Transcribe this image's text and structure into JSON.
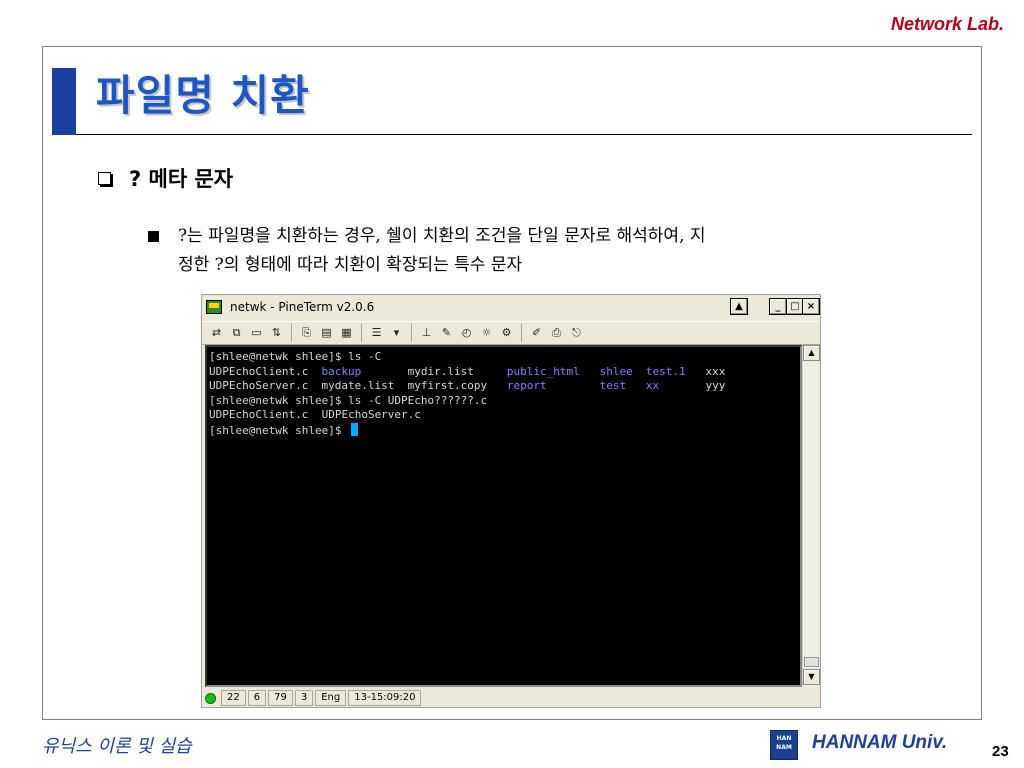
{
  "header": {
    "lab_label": "Network Lab."
  },
  "slide": {
    "title": "파일명 치환",
    "bullet1": "? 메타 문자",
    "bullet2_line1": "?는 파일명을 치환하는 경우, 쉘이 치환의 조건을 단일 문자로 해석하여, 지",
    "bullet2_line2": "정한 ?의 형태에 따라 치환이 확장되는 특수 문자"
  },
  "window": {
    "title": "netwk - PineTerm v2.0.6",
    "buttons": {
      "extra": "▲",
      "minimize": "_",
      "maximize": "□",
      "close": "×"
    }
  },
  "toolbar": {
    "icons": [
      "connect-icon",
      "disconnect-icon",
      "new-window-icon",
      "transfer-icon",
      "copy-icon",
      "paste-icon",
      "paste-all-icon",
      "menu-icon",
      "dropdown-icon",
      "line-icon",
      "log-icon",
      "capture-icon",
      "slow-icon",
      "settings-icon",
      "edit-icon",
      "print-icon",
      "exit-icon"
    ]
  },
  "terminal": {
    "lines": [
      {
        "cols": [
          {
            "text": "[shlee@netwk shlee]$ ls -C",
            "dir": false
          }
        ]
      },
      {
        "cols": [
          {
            "text": "UDPEchoClient.c",
            "dir": false
          },
          {
            "text": "backup",
            "dir": true
          },
          {
            "text": "mydir.list",
            "dir": false
          },
          {
            "text": "public_html",
            "dir": true
          },
          {
            "text": "shlee",
            "dir": true
          },
          {
            "text": "test.1",
            "dir": true
          },
          {
            "text": "xxx",
            "dir": false
          }
        ]
      },
      {
        "cols": [
          {
            "text": "UDPEchoServer.c",
            "dir": false
          },
          {
            "text": "mydate.list",
            "dir": false
          },
          {
            "text": "myfirst.copy",
            "dir": false
          },
          {
            "text": "report",
            "dir": true
          },
          {
            "text": "test",
            "dir": true
          },
          {
            "text": "xx",
            "dir": true
          },
          {
            "text": "yyy",
            "dir": false
          }
        ]
      },
      {
        "cols": [
          {
            "text": "[shlee@netwk shlee]$ ls -C UDPEcho??????.c",
            "dir": false
          }
        ]
      },
      {
        "cols": [
          {
            "text": "UDPEchoClient.c  UDPEchoServer.c",
            "dir": false
          }
        ]
      },
      {
        "cols": [
          {
            "text": "[shlee@netwk shlee]$ ",
            "dir": false
          }
        ],
        "cursor": true
      }
    ]
  },
  "statusbar": {
    "cells": [
      "22",
      "6",
      "79",
      "3",
      "Eng",
      "13-15:09:20"
    ]
  },
  "footer": {
    "course": "유닉스 이론 및 실습",
    "logo_text": "HAN NAM",
    "university": "HANNAM Univ.",
    "page_number": "23"
  },
  "colors": {
    "title": "#1f56c6",
    "accent_bar": "#1a3f9c",
    "lab_label": "#b3001b",
    "dir_listing": "#8080ff"
  }
}
